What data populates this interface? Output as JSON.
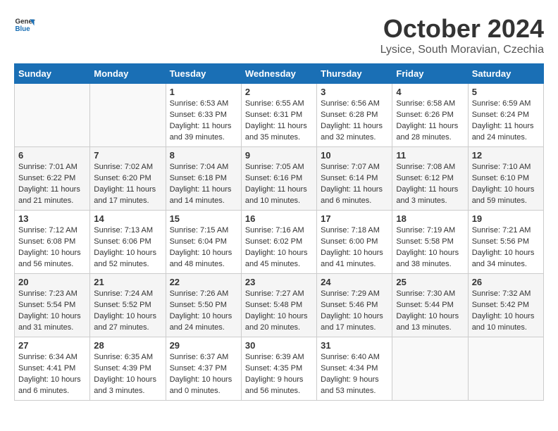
{
  "header": {
    "logo_general": "General",
    "logo_blue": "Blue",
    "title": "October 2024",
    "location": "Lysice, South Moravian, Czechia"
  },
  "days_of_week": [
    "Sunday",
    "Monday",
    "Tuesday",
    "Wednesday",
    "Thursday",
    "Friday",
    "Saturday"
  ],
  "weeks": [
    [
      {
        "day": "",
        "sunrise": "",
        "sunset": "",
        "daylight": ""
      },
      {
        "day": "",
        "sunrise": "",
        "sunset": "",
        "daylight": ""
      },
      {
        "day": "1",
        "sunrise": "Sunrise: 6:53 AM",
        "sunset": "Sunset: 6:33 PM",
        "daylight": "Daylight: 11 hours and 39 minutes."
      },
      {
        "day": "2",
        "sunrise": "Sunrise: 6:55 AM",
        "sunset": "Sunset: 6:31 PM",
        "daylight": "Daylight: 11 hours and 35 minutes."
      },
      {
        "day": "3",
        "sunrise": "Sunrise: 6:56 AM",
        "sunset": "Sunset: 6:28 PM",
        "daylight": "Daylight: 11 hours and 32 minutes."
      },
      {
        "day": "4",
        "sunrise": "Sunrise: 6:58 AM",
        "sunset": "Sunset: 6:26 PM",
        "daylight": "Daylight: 11 hours and 28 minutes."
      },
      {
        "day": "5",
        "sunrise": "Sunrise: 6:59 AM",
        "sunset": "Sunset: 6:24 PM",
        "daylight": "Daylight: 11 hours and 24 minutes."
      }
    ],
    [
      {
        "day": "6",
        "sunrise": "Sunrise: 7:01 AM",
        "sunset": "Sunset: 6:22 PM",
        "daylight": "Daylight: 11 hours and 21 minutes."
      },
      {
        "day": "7",
        "sunrise": "Sunrise: 7:02 AM",
        "sunset": "Sunset: 6:20 PM",
        "daylight": "Daylight: 11 hours and 17 minutes."
      },
      {
        "day": "8",
        "sunrise": "Sunrise: 7:04 AM",
        "sunset": "Sunset: 6:18 PM",
        "daylight": "Daylight: 11 hours and 14 minutes."
      },
      {
        "day": "9",
        "sunrise": "Sunrise: 7:05 AM",
        "sunset": "Sunset: 6:16 PM",
        "daylight": "Daylight: 11 hours and 10 minutes."
      },
      {
        "day": "10",
        "sunrise": "Sunrise: 7:07 AM",
        "sunset": "Sunset: 6:14 PM",
        "daylight": "Daylight: 11 hours and 6 minutes."
      },
      {
        "day": "11",
        "sunrise": "Sunrise: 7:08 AM",
        "sunset": "Sunset: 6:12 PM",
        "daylight": "Daylight: 11 hours and 3 minutes."
      },
      {
        "day": "12",
        "sunrise": "Sunrise: 7:10 AM",
        "sunset": "Sunset: 6:10 PM",
        "daylight": "Daylight: 10 hours and 59 minutes."
      }
    ],
    [
      {
        "day": "13",
        "sunrise": "Sunrise: 7:12 AM",
        "sunset": "Sunset: 6:08 PM",
        "daylight": "Daylight: 10 hours and 56 minutes."
      },
      {
        "day": "14",
        "sunrise": "Sunrise: 7:13 AM",
        "sunset": "Sunset: 6:06 PM",
        "daylight": "Daylight: 10 hours and 52 minutes."
      },
      {
        "day": "15",
        "sunrise": "Sunrise: 7:15 AM",
        "sunset": "Sunset: 6:04 PM",
        "daylight": "Daylight: 10 hours and 48 minutes."
      },
      {
        "day": "16",
        "sunrise": "Sunrise: 7:16 AM",
        "sunset": "Sunset: 6:02 PM",
        "daylight": "Daylight: 10 hours and 45 minutes."
      },
      {
        "day": "17",
        "sunrise": "Sunrise: 7:18 AM",
        "sunset": "Sunset: 6:00 PM",
        "daylight": "Daylight: 10 hours and 41 minutes."
      },
      {
        "day": "18",
        "sunrise": "Sunrise: 7:19 AM",
        "sunset": "Sunset: 5:58 PM",
        "daylight": "Daylight: 10 hours and 38 minutes."
      },
      {
        "day": "19",
        "sunrise": "Sunrise: 7:21 AM",
        "sunset": "Sunset: 5:56 PM",
        "daylight": "Daylight: 10 hours and 34 minutes."
      }
    ],
    [
      {
        "day": "20",
        "sunrise": "Sunrise: 7:23 AM",
        "sunset": "Sunset: 5:54 PM",
        "daylight": "Daylight: 10 hours and 31 minutes."
      },
      {
        "day": "21",
        "sunrise": "Sunrise: 7:24 AM",
        "sunset": "Sunset: 5:52 PM",
        "daylight": "Daylight: 10 hours and 27 minutes."
      },
      {
        "day": "22",
        "sunrise": "Sunrise: 7:26 AM",
        "sunset": "Sunset: 5:50 PM",
        "daylight": "Daylight: 10 hours and 24 minutes."
      },
      {
        "day": "23",
        "sunrise": "Sunrise: 7:27 AM",
        "sunset": "Sunset: 5:48 PM",
        "daylight": "Daylight: 10 hours and 20 minutes."
      },
      {
        "day": "24",
        "sunrise": "Sunrise: 7:29 AM",
        "sunset": "Sunset: 5:46 PM",
        "daylight": "Daylight: 10 hours and 17 minutes."
      },
      {
        "day": "25",
        "sunrise": "Sunrise: 7:30 AM",
        "sunset": "Sunset: 5:44 PM",
        "daylight": "Daylight: 10 hours and 13 minutes."
      },
      {
        "day": "26",
        "sunrise": "Sunrise: 7:32 AM",
        "sunset": "Sunset: 5:42 PM",
        "daylight": "Daylight: 10 hours and 10 minutes."
      }
    ],
    [
      {
        "day": "27",
        "sunrise": "Sunrise: 6:34 AM",
        "sunset": "Sunset: 4:41 PM",
        "daylight": "Daylight: 10 hours and 6 minutes."
      },
      {
        "day": "28",
        "sunrise": "Sunrise: 6:35 AM",
        "sunset": "Sunset: 4:39 PM",
        "daylight": "Daylight: 10 hours and 3 minutes."
      },
      {
        "day": "29",
        "sunrise": "Sunrise: 6:37 AM",
        "sunset": "Sunset: 4:37 PM",
        "daylight": "Daylight: 10 hours and 0 minutes."
      },
      {
        "day": "30",
        "sunrise": "Sunrise: 6:39 AM",
        "sunset": "Sunset: 4:35 PM",
        "daylight": "Daylight: 9 hours and 56 minutes."
      },
      {
        "day": "31",
        "sunrise": "Sunrise: 6:40 AM",
        "sunset": "Sunset: 4:34 PM",
        "daylight": "Daylight: 9 hours and 53 minutes."
      },
      {
        "day": "",
        "sunrise": "",
        "sunset": "",
        "daylight": ""
      },
      {
        "day": "",
        "sunrise": "",
        "sunset": "",
        "daylight": ""
      }
    ]
  ]
}
